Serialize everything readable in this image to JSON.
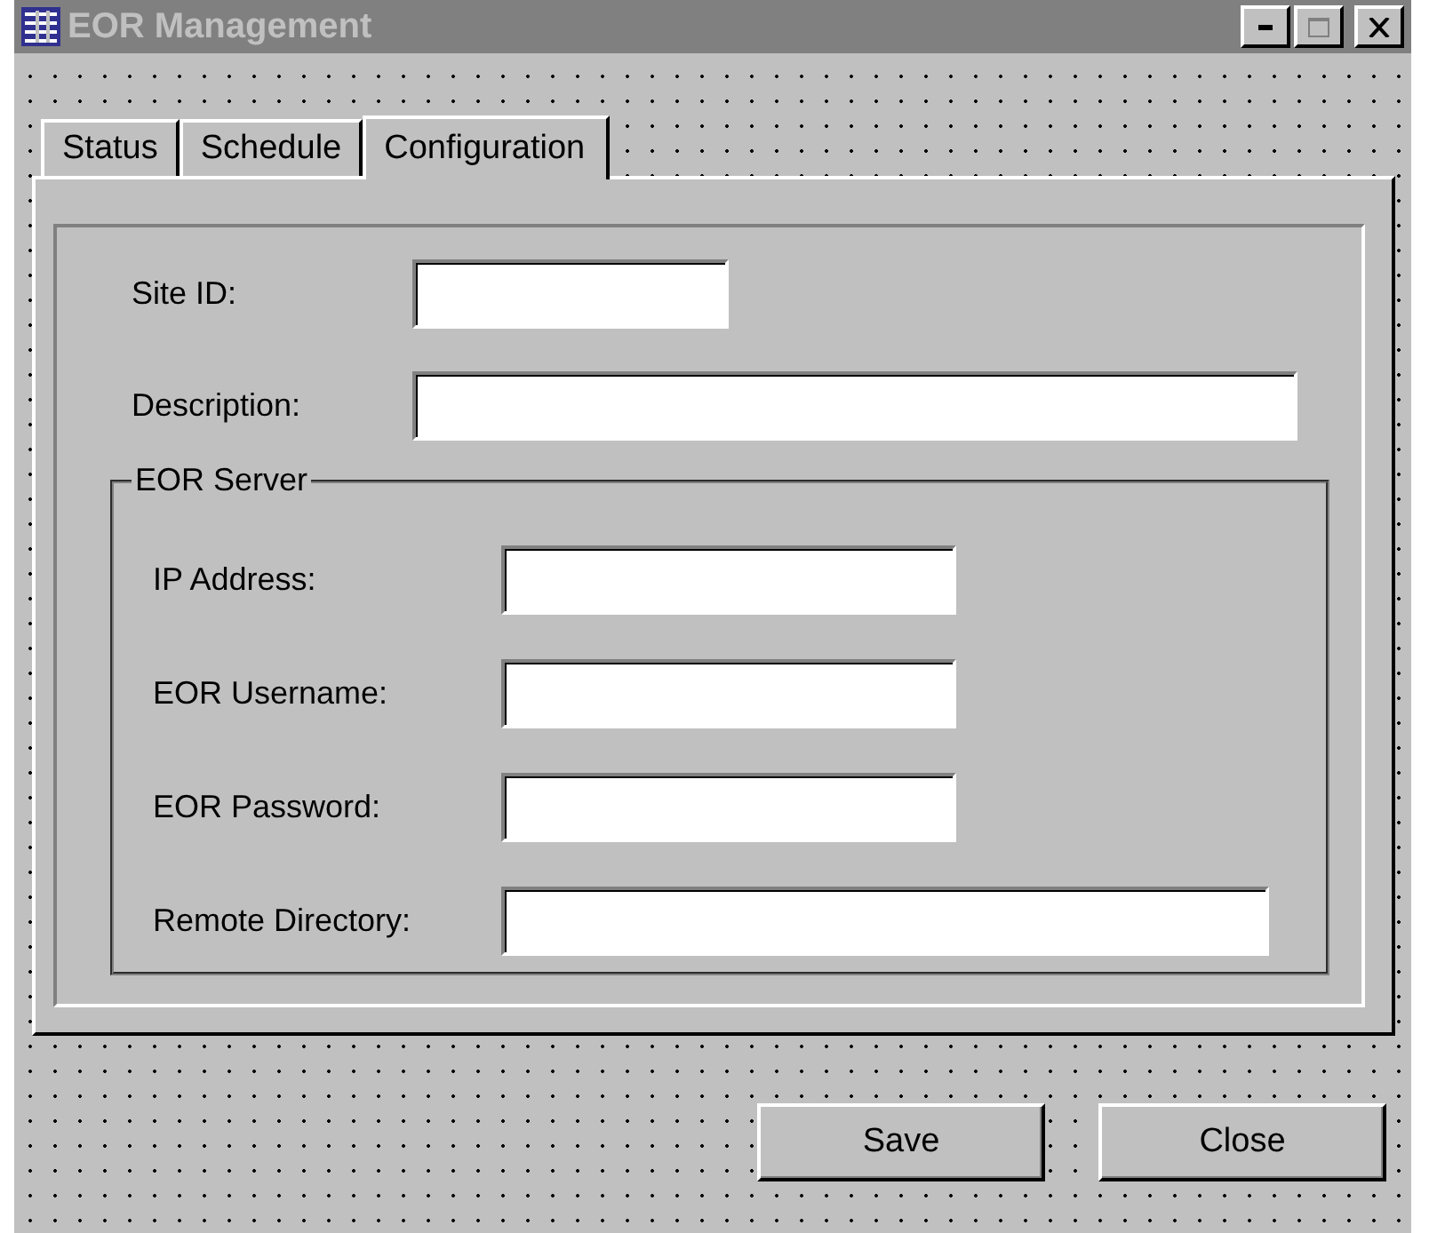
{
  "window": {
    "title": "EOR Management"
  },
  "tabs": [
    {
      "label": "Status",
      "selected": false
    },
    {
      "label": "Schedule",
      "selected": false
    },
    {
      "label": "Configuration",
      "selected": true
    }
  ],
  "fields": [
    {
      "label": "Site ID:",
      "kind": "short"
    },
    {
      "label": "Description:",
      "kind": "wide"
    }
  ],
  "group": {
    "title": "EOR Server",
    "fields": [
      {
        "label": "IP Address:",
        "kind": "short"
      },
      {
        "label": "EOR Username:",
        "kind": "short"
      },
      {
        "label": "EOR Password:",
        "kind": "short"
      },
      {
        "label": "Remote Directory:",
        "kind": "wide"
      }
    ]
  },
  "buttons": [
    "Save",
    "Close"
  ]
}
